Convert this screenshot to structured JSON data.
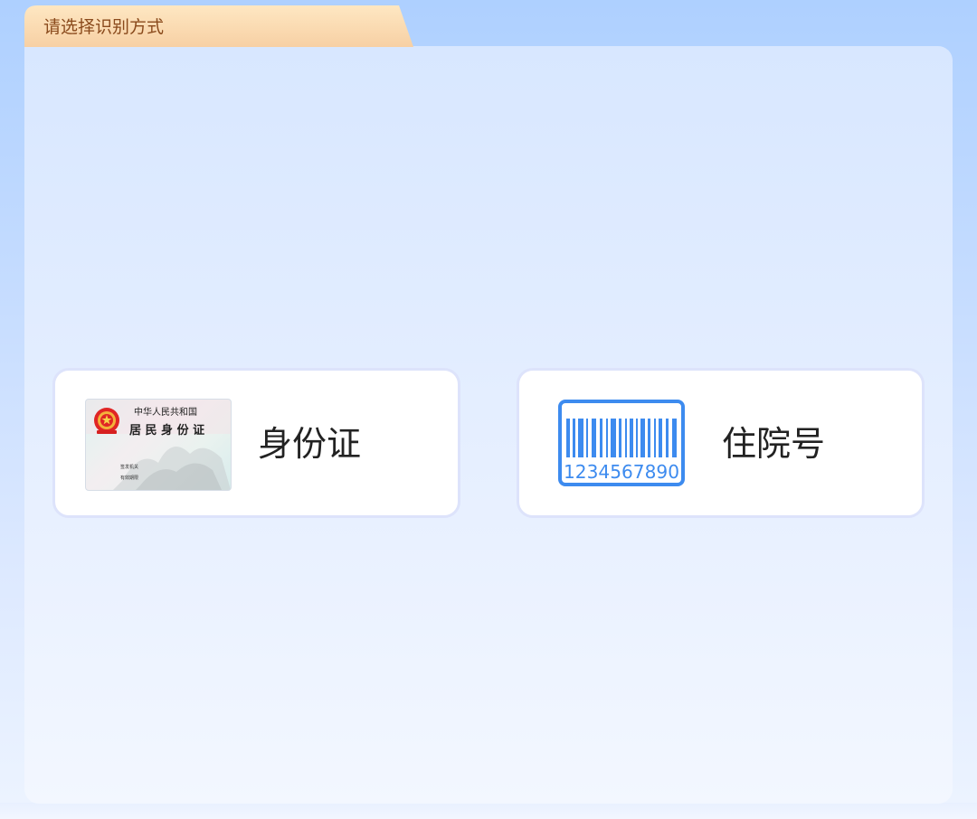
{
  "header": {
    "tab_title": "请选择识别方式"
  },
  "options": [
    {
      "label": "身份证",
      "icon": "id-card-icon",
      "card_text": {
        "country": "中华人民共和国",
        "title": "居 民 身 份 证",
        "issuing_authority": "签发机关",
        "validity": "有效期限"
      }
    },
    {
      "label": "住院号",
      "icon": "barcode-icon",
      "barcode_digits": "1234567890"
    }
  ],
  "colors": {
    "tab_fill_light": "#fde4bd",
    "tab_fill_dark": "#f6cfa0",
    "tab_text": "#8a4a1c",
    "barcode_blue": "#3d8bef",
    "card_border": "#dde3fb"
  }
}
